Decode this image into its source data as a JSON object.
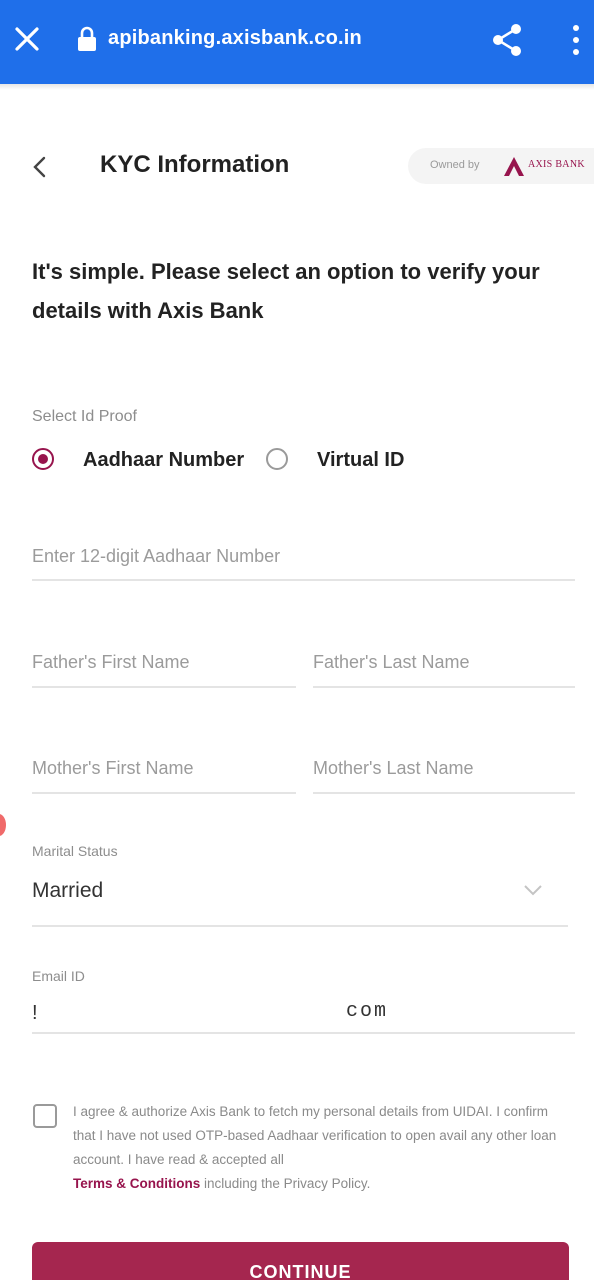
{
  "browser": {
    "url": "apibanking.axisbank.co.in"
  },
  "header": {
    "title": "KYC Information",
    "owned_by": "Owned by",
    "brand": "AXIS BANK"
  },
  "intro": "It's simple. Please select an option to verify your details with Axis Bank",
  "id_proof": {
    "label": "Select Id Proof",
    "options": [
      {
        "label": "Aadhaar Number",
        "selected": true
      },
      {
        "label": "Virtual ID",
        "selected": false
      }
    ]
  },
  "fields": {
    "aadhaar_placeholder": "Enter 12-digit Aadhaar Number",
    "father_first_placeholder": "Father's First Name",
    "father_last_placeholder": "Father's Last Name",
    "mother_first_placeholder": "Mother's First Name",
    "mother_last_placeholder": "Mother's Last Name"
  },
  "marital_status": {
    "label": "Marital Status",
    "value": "Married"
  },
  "email": {
    "label": "Email ID",
    "value_start": "!",
    "value_end": "com"
  },
  "consent": {
    "text": "I agree & authorize Axis Bank to fetch my personal details from UIDAI. I confirm that I have not used OTP-based Aadhaar verification to open avail any other loan account. I have read & accepted all",
    "terms_link": "Terms & Conditions",
    "suffix": "including the Privacy Policy."
  },
  "continue_label": "CONTINUE",
  "colors": {
    "browser_bar": "#1f6fea",
    "accent": "#97144d",
    "button": "#a5264f"
  }
}
